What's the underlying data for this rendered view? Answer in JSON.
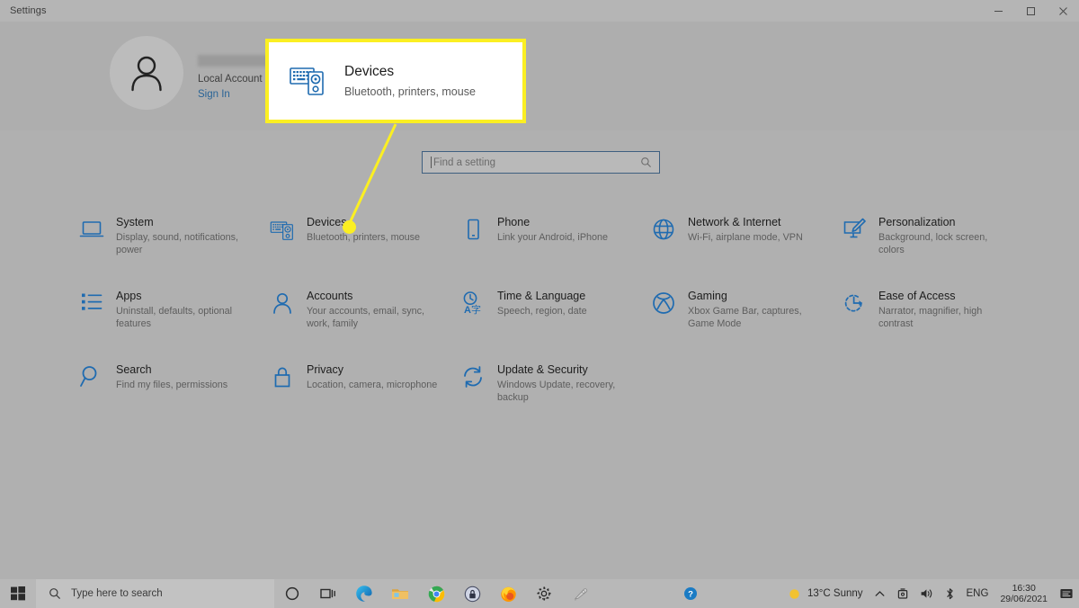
{
  "window": {
    "title": "Settings",
    "controls": {
      "minimize": "Minimize",
      "maximize": "Restore",
      "close": "Close"
    }
  },
  "account": {
    "name_redacted": true,
    "account_type": "Local Account",
    "sign_in_label": "Sign In"
  },
  "callout": {
    "title": "Devices",
    "subtitle": "Bluetooth, printers, mouse",
    "icon": "devices-icon",
    "border_color": "#FBEF22",
    "background": "#FFFFFF"
  },
  "search": {
    "placeholder": "Find a setting",
    "icon": "search-icon"
  },
  "settings_tiles": [
    {
      "icon": "laptop-icon",
      "title": "System",
      "subtitle": "Display, sound, notifications, power"
    },
    {
      "icon": "devices-icon",
      "title": "Devices",
      "subtitle": "Bluetooth, printers, mouse"
    },
    {
      "icon": "phone-icon",
      "title": "Phone",
      "subtitle": "Link your Android, iPhone"
    },
    {
      "icon": "globe-icon",
      "title": "Network & Internet",
      "subtitle": "Wi-Fi, airplane mode, VPN"
    },
    {
      "icon": "paintbrush-monitor-icon",
      "title": "Personalization",
      "subtitle": "Background, lock screen, colors"
    },
    {
      "icon": "list-icon",
      "title": "Apps",
      "subtitle": "Uninstall, defaults, optional features"
    },
    {
      "icon": "person-icon",
      "title": "Accounts",
      "subtitle": "Your accounts, email, sync, work, family"
    },
    {
      "icon": "clock-language-icon",
      "title": "Time & Language",
      "subtitle": "Speech, region, date"
    },
    {
      "icon": "xbox-icon",
      "title": "Gaming",
      "subtitle": "Xbox Game Bar, captures, Game Mode"
    },
    {
      "icon": "clock-arrow-icon",
      "title": "Ease of Access",
      "subtitle": "Narrator, magnifier, high contrast"
    },
    {
      "icon": "magnifier-icon",
      "title": "Search",
      "subtitle": "Find my files, permissions"
    },
    {
      "icon": "lock-icon",
      "title": "Privacy",
      "subtitle": "Location, camera, microphone"
    },
    {
      "icon": "refresh-icon",
      "title": "Update & Security",
      "subtitle": "Windows Update, recovery, backup"
    }
  ],
  "taskbar": {
    "start_icon": "windows-start-icon",
    "search_placeholder": "Type here to search",
    "search_icon": "search-icon",
    "pinned": [
      {
        "icon": "cortana-icon",
        "name": "Cortana"
      },
      {
        "icon": "task-view-icon",
        "name": "Task View"
      },
      {
        "icon": "edge-icon",
        "name": "Microsoft Edge"
      },
      {
        "icon": "file-explorer-icon",
        "name": "File Explorer"
      },
      {
        "icon": "chrome-icon",
        "name": "Google Chrome"
      },
      {
        "icon": "lock-app-icon",
        "name": "Password Manager"
      },
      {
        "icon": "firefox-icon",
        "name": "Mozilla Firefox"
      },
      {
        "icon": "gear-icon",
        "name": "Settings"
      },
      {
        "icon": "snipping-tool-icon",
        "name": "Snipping Tool"
      }
    ],
    "tray": {
      "help_icon": "help-circle-icon",
      "weather_icon": "sun-icon",
      "weather_text": "13°C  Sunny",
      "chevron_icon": "chevron-up-icon",
      "device_icon": "removable-media-icon",
      "volume_icon": "speaker-icon",
      "bluetooth_icon": "bluetooth-icon",
      "language": "ENG",
      "time": "16:30",
      "date": "29/06/2021",
      "notifications_icon": "notification-icon"
    }
  },
  "colors": {
    "accent_blue": "#2A6496",
    "icon_blue": "#1F6BB0",
    "highlight_yellow": "#FBEF22",
    "desktop_gray": "#B0B0B0"
  }
}
